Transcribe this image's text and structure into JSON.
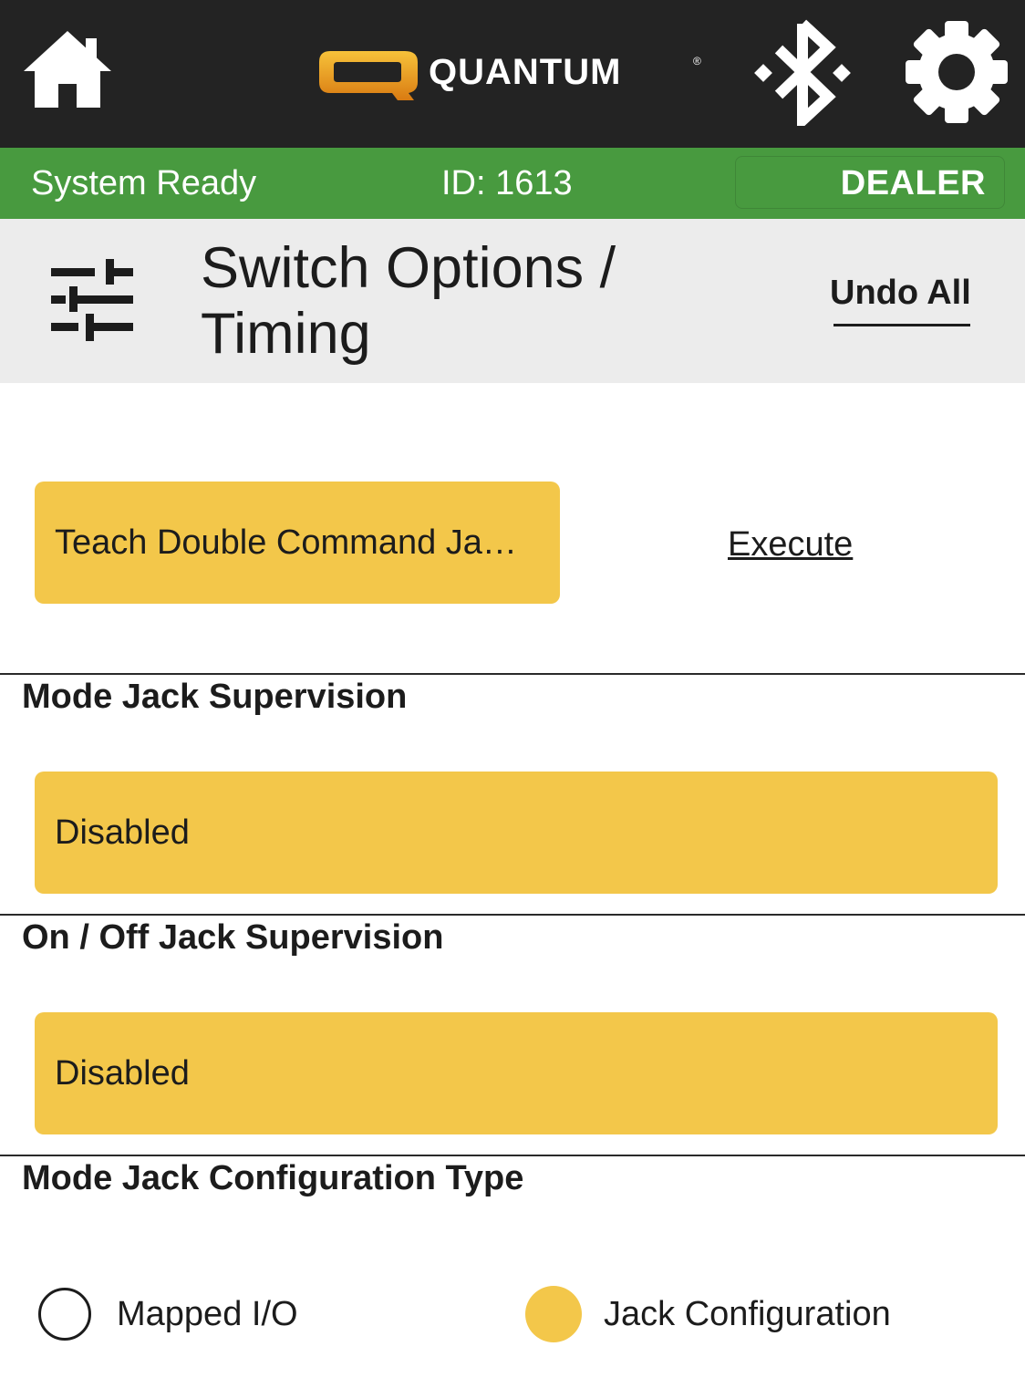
{
  "app": {
    "brand": "QUANTUM",
    "brand_mark": "®",
    "icons": {
      "home": "home-icon",
      "bluetooth": "bluetooth-icon",
      "settings": "gear-icon",
      "page": "sliders-icon"
    }
  },
  "status_bar": {
    "status": "System Ready",
    "id": "ID: 1613",
    "role": "DEALER"
  },
  "header": {
    "title": "Switch Options / Timing",
    "undo_all": "Undo All"
  },
  "teach": {
    "label": "Teach Double Command Ja…",
    "action": "Execute"
  },
  "sections": [
    {
      "label": "Mode Jack Supervision",
      "value": "Disabled"
    },
    {
      "label": "On / Off Jack Supervision",
      "value": "Disabled"
    },
    {
      "label": "Mode Jack Configuration Type"
    }
  ],
  "config_type": {
    "options": [
      {
        "label": "Mapped I/O",
        "selected": false
      },
      {
        "label": "Jack Configuration",
        "selected": true
      }
    ]
  },
  "colors": {
    "topbar": "#232323",
    "status_green": "#489a3f",
    "accent_yellow": "#f3c74a",
    "header_gray": "#ececec",
    "logo_orange": "#f0a020"
  }
}
